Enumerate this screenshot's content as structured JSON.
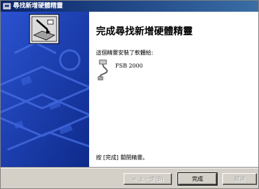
{
  "window": {
    "title": "尋找新增硬體精靈"
  },
  "page": {
    "heading": "完成尋找新增硬體精靈",
    "description": "這個精靈安裝了軟體給:",
    "device_name": "FSB 2000",
    "finish_hint": "按 [完成] 關閉精靈。"
  },
  "buttons": {
    "back_label": "< 上一步(B)",
    "finish_label": "完成",
    "cancel_label": "取消"
  },
  "colors": {
    "titlebar": "#0a246a",
    "banner": "#1d3fb5",
    "dialog": "#d4d0c8"
  },
  "icons": {
    "title": "wizard-icon",
    "banner": "hardware-wizard-illustration",
    "device": "usb-device-icon"
  }
}
